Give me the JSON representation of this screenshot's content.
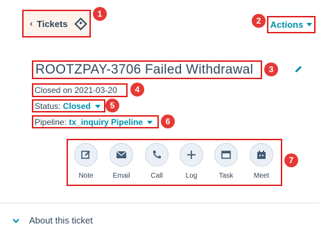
{
  "breadcrumb": {
    "label": "Tickets",
    "back_icon": "chevron-left-icon",
    "icon": "ticket-icon"
  },
  "header": {
    "actions_label": "Actions"
  },
  "ticket": {
    "title": "ROOTZPAY-3706 Failed Withdrawal",
    "closed_text": "Closed on 2021-03-20",
    "status_label": "Status:",
    "status_value": "Closed",
    "pipeline_label": "Pipeline:",
    "pipeline_value": "tx_inquiry Pipeline"
  },
  "actions": [
    {
      "label": "Note",
      "icon": "note-icon"
    },
    {
      "label": "Email",
      "icon": "email-icon"
    },
    {
      "label": "Call",
      "icon": "phone-icon"
    },
    {
      "label": "Log",
      "icon": "plus-icon"
    },
    {
      "label": "Task",
      "icon": "task-icon"
    },
    {
      "label": "Meet",
      "icon": "calendar-icon"
    }
  ],
  "about": {
    "label": "About this ticket"
  },
  "annotations": [
    "1",
    "2",
    "3",
    "4",
    "5",
    "6",
    "7"
  ],
  "colors": {
    "accent": "#0091ae",
    "annotation": "#e02020",
    "text": "#33475b"
  }
}
